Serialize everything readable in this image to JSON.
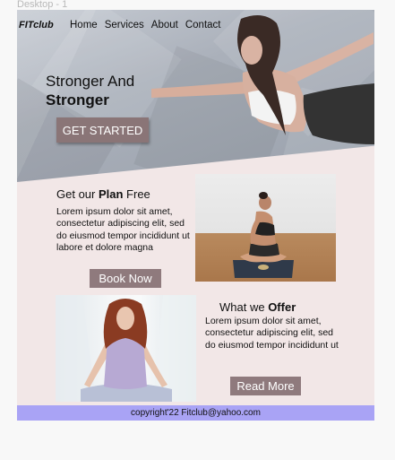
{
  "frame_label": "Desktop - 1",
  "nav": {
    "logo": "FITclub",
    "items": [
      "Home",
      "Services",
      "About",
      "Contact"
    ]
  },
  "hero": {
    "title_line1": "Stronger And",
    "title_line2": "Stronger",
    "cta": "GET STARTED"
  },
  "plan": {
    "title_pre": "Get our ",
    "title_bold": "Plan",
    "title_post": " Free",
    "text": "Lorem ipsum dolor sit amet, consectetur adipiscing elit, sed do eiusmod tempor incididunt ut labore et dolore magna",
    "button": "Book Now"
  },
  "offer": {
    "title_pre": "What we ",
    "title_bold": "Offer",
    "text": "Lorem ipsum dolor sit amet, consectetur adipiscing elit, sed do eiusmod tempor incididunt ut",
    "button": "Read More"
  },
  "footer": {
    "text": "copyright'22 Fitclub@yahoo.com"
  },
  "colors": {
    "page_bg": "#f2e7e7",
    "button": "#8f7a7d",
    "footer": "#a9a3f5"
  }
}
